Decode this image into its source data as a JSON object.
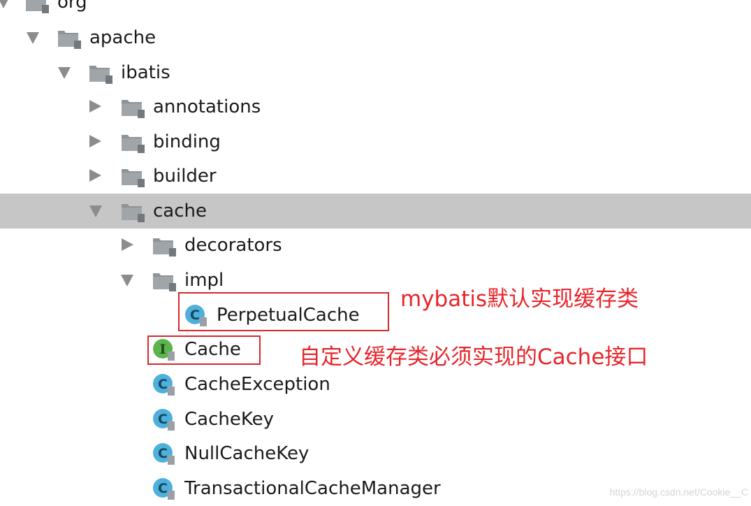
{
  "tree": {
    "org": "org",
    "apache": "apache",
    "ibatis": "ibatis",
    "annotations": "annotations",
    "binding": "binding",
    "builder": "builder",
    "cache": "cache",
    "decorators": "decorators",
    "impl": "impl",
    "perpetual_cache": "PerpetualCache",
    "cache_iface": "Cache",
    "cache_exception": "CacheException",
    "cache_key": "CacheKey",
    "null_cache_key": "NullCacheKey",
    "transactional_cache_manager": "TransactionalCacheManager"
  },
  "badges": {
    "class": "C",
    "interface": "I"
  },
  "annotations": {
    "note1": "mybatis默认实现缓存类",
    "note2": "自定义缓存类必须实现的Cache接口"
  },
  "watermark": "https://blog.csdn.net/Cookie__C",
  "colors": {
    "selection": "#c6c6c6",
    "class_badge": "#4fb0dc",
    "interface_badge": "#5bb44d",
    "annotation_red": "#e8252b"
  }
}
